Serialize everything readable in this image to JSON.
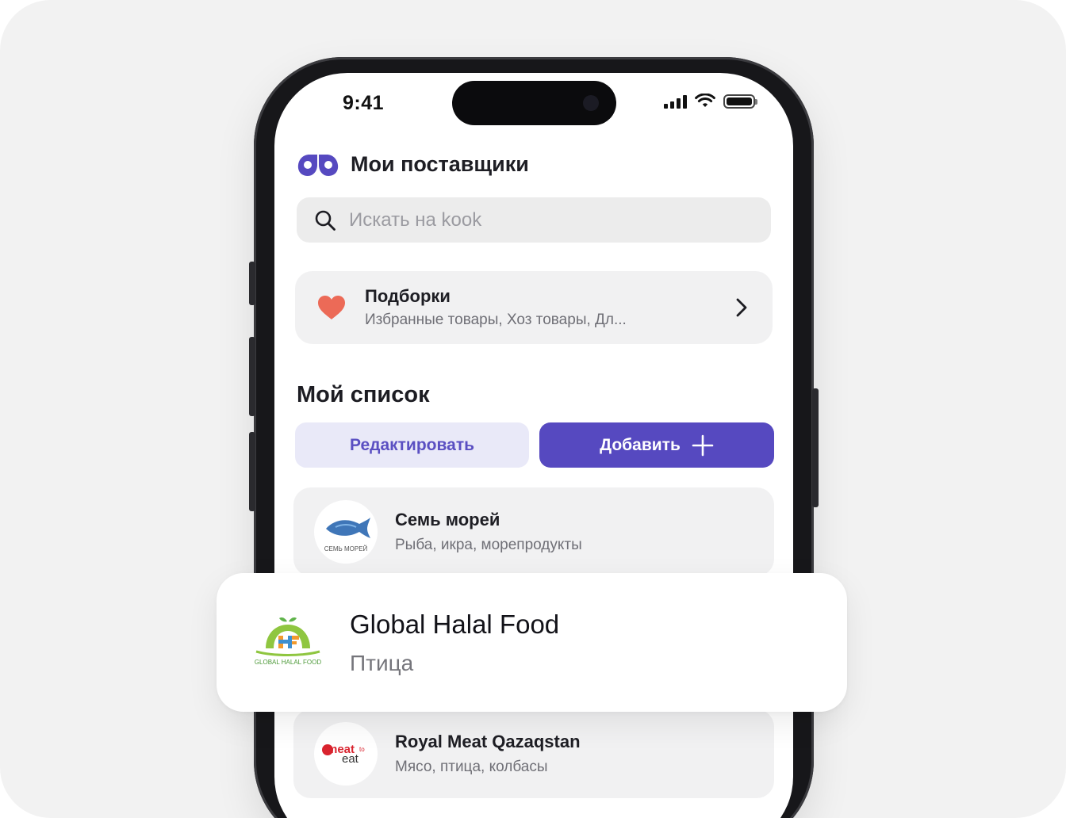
{
  "status_bar": {
    "time": "9:41"
  },
  "header": {
    "title": "Мои поставщики"
  },
  "search": {
    "placeholder": "Искать на kook"
  },
  "collections": {
    "title": "Подборки",
    "subtitle": "Избранные товары, Хоз товары, Дл..."
  },
  "my_list": {
    "title": "Мой список",
    "edit_label": "Редактировать",
    "add_label": "Добавить"
  },
  "suppliers": [
    {
      "name": "Семь морей",
      "subtitle": "Рыба, икра, морепродукты",
      "logo_text": "СЕМЬ МОРЕЙ"
    },
    {
      "name": "Royal Meat Qazaqstan",
      "subtitle": "Мясо, птица, колбасы",
      "logo_text_1": "meat",
      "logo_text_2": "to",
      "logo_text_3": "eat"
    }
  ],
  "featured_supplier": {
    "name": "Global Halal Food",
    "subtitle": "Птица",
    "logo_text": "GLOBAL HALAL FOOD"
  },
  "colors": {
    "accent": "#5649c0",
    "accent_light": "#e9e9f8",
    "heart": "#ec6a57",
    "background": "#f2f2f2"
  },
  "icons": [
    "kook-logo-icon",
    "search-icon",
    "heart-icon",
    "chevron-right-icon",
    "plus-icon",
    "signal-icon",
    "wifi-icon",
    "battery-icon"
  ]
}
